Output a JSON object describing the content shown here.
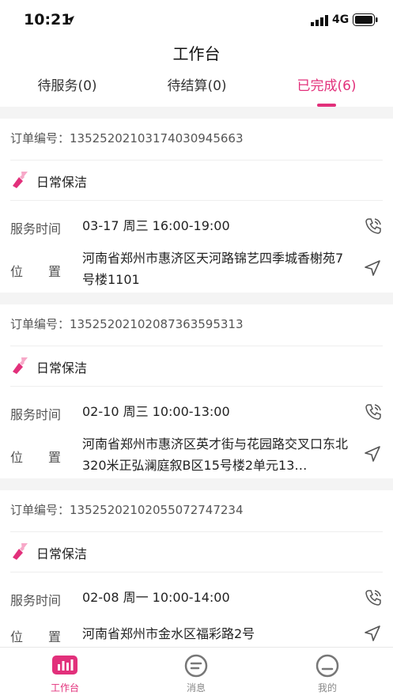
{
  "status": {
    "time": "10:21",
    "network": "4G"
  },
  "header": {
    "title": "工作台"
  },
  "tabs": [
    {
      "label": "待服务(0)"
    },
    {
      "label": "待结算(0)"
    },
    {
      "label": "已完成(6)"
    }
  ],
  "labels": {
    "service_time": "服务时间",
    "location": "位置"
  },
  "orders": [
    {
      "order_no": "订单编号：1352520210317403094566​3",
      "service": "日常保洁",
      "time": "03-17 周三 16:00-19:00",
      "address": "河南省郑州市惠济区天河路锦艺四季城香榭苑7号楼1101"
    },
    {
      "order_no": "订单编号：1352520210208736359531​3",
      "service": "日常保洁",
      "time": "02-10 周三 10:00-13:00",
      "address": "河南省郑州市惠济区英才街与花园路交叉口东北320米正弘澜庭叙B区15号楼2单元13…"
    },
    {
      "order_no": "订单编号：1352520210205507274723​4",
      "service": "日常保洁",
      "time": "02-08 周一 10:00-14:00",
      "address": "河南省郑州市金水区福彩路2号"
    }
  ],
  "bottom_nav": [
    {
      "label": "工作台"
    },
    {
      "label": "消息"
    },
    {
      "label": "我的"
    }
  ],
  "colors": {
    "accent": "#e2307b",
    "accent_light": "#f7a8c8"
  }
}
